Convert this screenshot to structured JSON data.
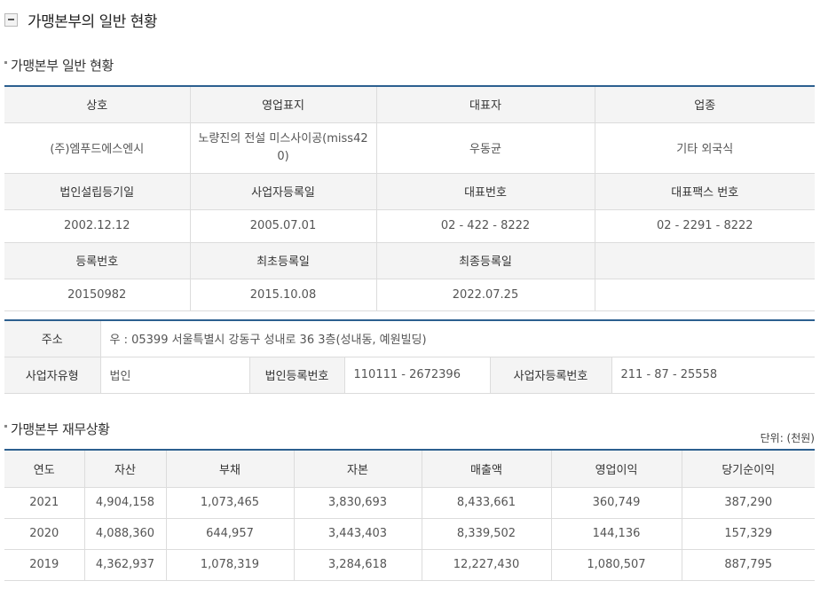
{
  "title": "가맹본부의 일반 현황",
  "general": {
    "heading": "가맹본부 일반 현황",
    "rows": [
      {
        "headers": [
          "상호",
          "영업표지",
          "대표자",
          "업종"
        ],
        "values": [
          "(주)엠푸드에스엔시",
          "노량진의 전설 미스사이공(miss420)",
          "우동균",
          "기타 외국식"
        ]
      },
      {
        "headers": [
          "법인설립등기일",
          "사업자등록일",
          "대표번호",
          "대표팩스 번호"
        ],
        "values": [
          "2002.12.12",
          "2005.07.01",
          "02 - 422 - 8222",
          "02 - 2291 - 8222"
        ]
      },
      {
        "headers": [
          "등록번호",
          "최초등록일",
          "최종등록일",
          ""
        ],
        "values": [
          "20150982",
          "2015.10.08",
          "2022.07.25",
          ""
        ]
      }
    ]
  },
  "address": {
    "label": "주소",
    "value": "우 : 05399 서울특별시 강동구 성내로 36 3층(성내동, 예원빌딩)",
    "biz_type_label": "사업자유형",
    "biz_type_value": "법인",
    "corp_no_label": "법인등록번호",
    "corp_no_value": "110111 - 2672396",
    "biz_no_label": "사업자등록번호",
    "biz_no_value": "211 - 87 - 25558"
  },
  "finance": {
    "heading": "가맹본부 재무상황",
    "unit": "단위: (천원)",
    "columns": [
      "연도",
      "자산",
      "부채",
      "자본",
      "매출액",
      "영업이익",
      "당기순이익"
    ],
    "rows": [
      [
        "2021",
        "4,904,158",
        "1,073,465",
        "3,830,693",
        "8,433,661",
        "360,749",
        "387,290"
      ],
      [
        "2020",
        "4,088,360",
        "644,957",
        "3,443,403",
        "8,339,502",
        "144,136",
        "157,329"
      ],
      [
        "2019",
        "4,362,937",
        "1,078,319",
        "3,284,618",
        "12,227,430",
        "1,080,507",
        "887,795"
      ]
    ]
  },
  "colors": {
    "accent": "#2c5f8f",
    "header_bg": "#f4f4f4",
    "border": "#dcdcdc"
  }
}
